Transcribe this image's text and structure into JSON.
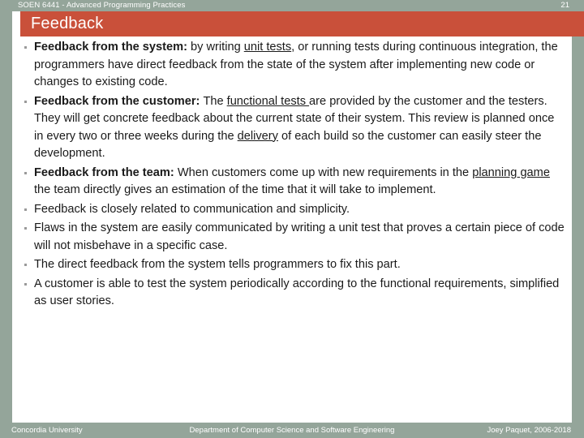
{
  "header": {
    "course": "SOEN 6441 - Advanced Programming Practices",
    "page_number": "21"
  },
  "title": "Feedback",
  "colors": {
    "accent": "#c9503a",
    "band": "#94a59a",
    "text": "#1a1a1a",
    "bullet": "#9a9a9a"
  },
  "bullets": [
    {
      "lead": "Feedback from the system",
      "sep": ": ",
      "pre": "by writing ",
      "link": "unit tests",
      "post": ", or running tests during continuous integration, the programmers have direct feedback from the state of the system after implementing new code or changes to existing code."
    },
    {
      "lead": "Feedback from the customer",
      "sep": ": ",
      "pre": "The ",
      "link": "functional tests ",
      "post": "are provided by the customer and the testers. They will get concrete feedback about the current state of their system. This review is planned once in every two or three weeks during the "
    },
    {
      "lead": "Feedback from the team",
      "sep": ": ",
      "pre": "When customers come up with new requirements in the ",
      "link": "planning game",
      "post": " the team directly gives an estimation of the time that it will take to implement."
    },
    {
      "text": "Feedback is closely related to communication and simplicity."
    },
    {
      "text": "Flaws in the system are easily communicated by writing a unit test that proves a certain piece of code will not misbehave in a specific case."
    },
    {
      "text": "The direct feedback from the system tells programmers to fix this part."
    },
    {
      "text": "A customer is able to test the system periodically according to the functional requirements, simplified as user stories."
    }
  ],
  "bullet2_tail": {
    "link": "delivery",
    "post": " of each build so the customer can easily steer the development."
  },
  "footer": {
    "left": "Concordia University",
    "center": "Department of Computer Science and Software Engineering",
    "right": "Joey Paquet, 2006-2018"
  }
}
